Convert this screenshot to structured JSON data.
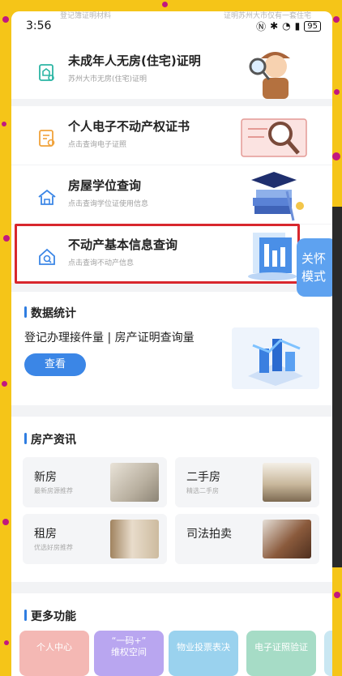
{
  "status_bar": {
    "time": "3:56",
    "faded_left": "登记簿证明材料",
    "faded_right": "证明苏州大市仅有一套住宅",
    "battery": "95"
  },
  "services": [
    {
      "title": "未成年人无房(住宅)证明",
      "subtitle": "苏州大市无房(住宅)证明",
      "icon": "house-certificate-icon"
    },
    {
      "title": "个人电子不动产权证书",
      "subtitle": "点击查询电子证照",
      "icon": "certificate-icon"
    },
    {
      "title": "房屋学位查询",
      "subtitle": "点击查询学位证使用信息",
      "icon": "school-house-icon"
    },
    {
      "title": "不动产基本信息查询",
      "subtitle": "点击查询不动产信息",
      "icon": "home-search-icon"
    }
  ],
  "care_mode": {
    "line1": "关怀",
    "line2": "模式"
  },
  "stats": {
    "title": "数据统计",
    "description": "登记办理接件量 | 房产证明查询量",
    "button": "查看"
  },
  "news": {
    "title": "房产资讯",
    "items": [
      {
        "title": "新房",
        "subtitle": "最新房源推荐"
      },
      {
        "title": "二手房",
        "subtitle": "精选二手房"
      },
      {
        "title": "租房",
        "subtitle": "优选好房推荐"
      },
      {
        "title": "司法拍卖",
        "subtitle": ""
      }
    ]
  },
  "more": {
    "title": "更多功能",
    "items": [
      {
        "label": "个人中心"
      },
      {
        "label": "“一码+”\n维权空间"
      },
      {
        "label": "物业投票表决"
      },
      {
        "label": "电子证照验证"
      }
    ]
  },
  "colors": {
    "accent": "#3b86e6",
    "highlight": "#d8272d",
    "frame": "#f5c518"
  }
}
